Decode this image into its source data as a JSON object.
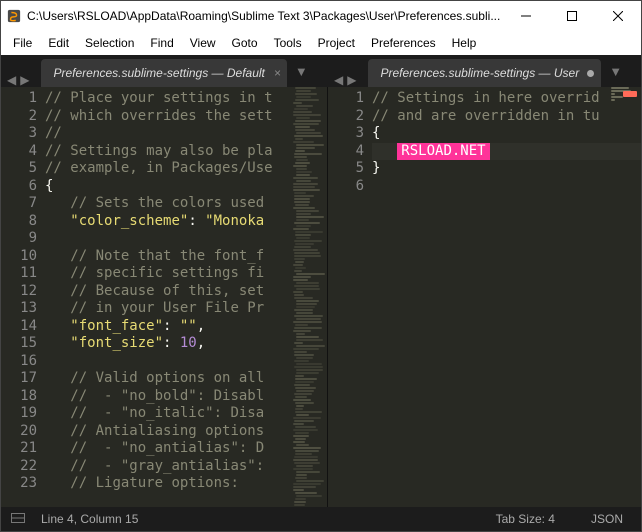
{
  "titlebar": {
    "title": "C:\\Users\\RSLOAD\\AppData\\Roaming\\Sublime Text 3\\Packages\\User\\Preferences.subli..."
  },
  "menu": [
    "File",
    "Edit",
    "Selection",
    "Find",
    "View",
    "Goto",
    "Tools",
    "Project",
    "Preferences",
    "Help"
  ],
  "tabs": {
    "left": {
      "label": "Preferences.sublime-settings — Default"
    },
    "right": {
      "label": "Preferences.sublime-settings — User"
    }
  },
  "left_lines": [
    {
      "n": 1,
      "spans": [
        {
          "c": "cmt",
          "t": "// Place your settings in t"
        }
      ]
    },
    {
      "n": 2,
      "spans": [
        {
          "c": "cmt",
          "t": "// which overrides the sett"
        }
      ]
    },
    {
      "n": 3,
      "spans": [
        {
          "c": "cmt",
          "t": "//"
        }
      ]
    },
    {
      "n": 4,
      "spans": [
        {
          "c": "cmt",
          "t": "// Settings may also be pla"
        }
      ]
    },
    {
      "n": 5,
      "spans": [
        {
          "c": "cmt",
          "t": "// example, in Packages/Use"
        }
      ]
    },
    {
      "n": 6,
      "spans": [
        {
          "c": "punc",
          "t": "{"
        }
      ]
    },
    {
      "n": 7,
      "spans": [
        {
          "c": "",
          "t": "   "
        },
        {
          "c": "cmt",
          "t": "// Sets the colors used"
        }
      ]
    },
    {
      "n": 8,
      "spans": [
        {
          "c": "",
          "t": "   "
        },
        {
          "c": "key",
          "t": "\"color_scheme\""
        },
        {
          "c": "punc",
          "t": ": "
        },
        {
          "c": "str",
          "t": "\"Monoka"
        }
      ]
    },
    {
      "n": 9,
      "spans": []
    },
    {
      "n": 10,
      "spans": [
        {
          "c": "",
          "t": "   "
        },
        {
          "c": "cmt",
          "t": "// Note that the font_f"
        }
      ]
    },
    {
      "n": 11,
      "spans": [
        {
          "c": "",
          "t": "   "
        },
        {
          "c": "cmt",
          "t": "// specific settings fi"
        }
      ]
    },
    {
      "n": 12,
      "spans": [
        {
          "c": "",
          "t": "   "
        },
        {
          "c": "cmt",
          "t": "// Because of this, set"
        }
      ]
    },
    {
      "n": 13,
      "spans": [
        {
          "c": "",
          "t": "   "
        },
        {
          "c": "cmt",
          "t": "// in your User File Pr"
        }
      ]
    },
    {
      "n": 14,
      "spans": [
        {
          "c": "",
          "t": "   "
        },
        {
          "c": "key",
          "t": "\"font_face\""
        },
        {
          "c": "punc",
          "t": ": "
        },
        {
          "c": "str",
          "t": "\"\""
        },
        {
          "c": "punc",
          "t": ","
        }
      ]
    },
    {
      "n": 15,
      "spans": [
        {
          "c": "",
          "t": "   "
        },
        {
          "c": "key",
          "t": "\"font_size\""
        },
        {
          "c": "punc",
          "t": ": "
        },
        {
          "c": "num",
          "t": "10"
        },
        {
          "c": "punc",
          "t": ","
        }
      ]
    },
    {
      "n": 16,
      "spans": []
    },
    {
      "n": 17,
      "spans": [
        {
          "c": "",
          "t": "   "
        },
        {
          "c": "cmt",
          "t": "// Valid options on all"
        }
      ]
    },
    {
      "n": 18,
      "spans": [
        {
          "c": "",
          "t": "   "
        },
        {
          "c": "cmt",
          "t": "//  - \"no_bold\": Disabl"
        }
      ]
    },
    {
      "n": 19,
      "spans": [
        {
          "c": "",
          "t": "   "
        },
        {
          "c": "cmt",
          "t": "//  - \"no_italic\": Disa"
        }
      ]
    },
    {
      "n": 20,
      "spans": [
        {
          "c": "",
          "t": "   "
        },
        {
          "c": "cmt",
          "t": "// Antialiasing options"
        }
      ]
    },
    {
      "n": 21,
      "spans": [
        {
          "c": "",
          "t": "   "
        },
        {
          "c": "cmt",
          "t": "//  - \"no_antialias\": D"
        }
      ]
    },
    {
      "n": 22,
      "spans": [
        {
          "c": "",
          "t": "   "
        },
        {
          "c": "cmt",
          "t": "//  - \"gray_antialias\":"
        }
      ]
    },
    {
      "n": 23,
      "spans": [
        {
          "c": "",
          "t": "   "
        },
        {
          "c": "cmt",
          "t": "// Ligature options:"
        }
      ]
    }
  ],
  "right_lines": [
    {
      "n": 1,
      "spans": [
        {
          "c": "cmt",
          "t": "// Settings in here overrid"
        }
      ]
    },
    {
      "n": 2,
      "spans": [
        {
          "c": "cmt",
          "t": "// and are overridden in tu"
        }
      ]
    },
    {
      "n": 3,
      "spans": [
        {
          "c": "punc",
          "t": "{"
        }
      ]
    },
    {
      "n": 4,
      "spans": [
        {
          "c": "",
          "t": "   "
        },
        {
          "c": "hl-badge",
          "t": "RSLOAD.NET"
        }
      ]
    },
    {
      "n": 5,
      "spans": [
        {
          "c": "punc",
          "t": "}"
        }
      ]
    },
    {
      "n": 6,
      "spans": []
    }
  ],
  "status": {
    "cursor": "Line 4, Column 15",
    "tabsize": "Tab Size: 4",
    "syntax": "JSON"
  }
}
